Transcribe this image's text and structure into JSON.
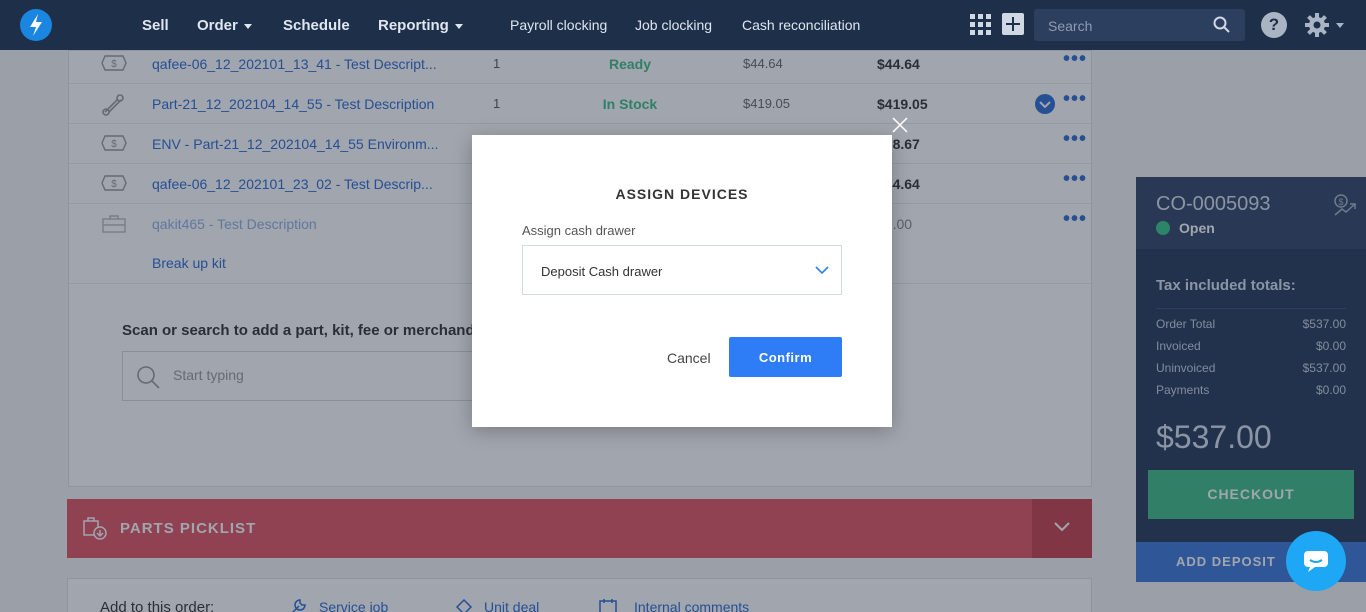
{
  "nav": {
    "items": [
      {
        "label": "Sell",
        "dropdown": false
      },
      {
        "label": "Order",
        "dropdown": true
      },
      {
        "label": "Schedule",
        "dropdown": false
      },
      {
        "label": "Reporting",
        "dropdown": true
      }
    ],
    "sub_items": [
      "Payroll clocking",
      "Job clocking",
      "Cash reconciliation"
    ],
    "search_placeholder": "Search",
    "help_label": "?"
  },
  "line_items": [
    {
      "name": "qafee-06_12_202101_13_41 - Test Descript...",
      "qty": "1",
      "status": "Ready",
      "status_color": "#3dbd86",
      "price": "$44.64",
      "total": "$44.64",
      "icon": "fee-icon"
    },
    {
      "name": "Part-21_12_202104_14_55 - Test Description",
      "qty": "1",
      "status": "In Stock",
      "status_color": "#3dbd86",
      "price": "$419.05",
      "total": "$419.05",
      "icon": "part-icon"
    },
    {
      "name": "ENV - Part-21_12_202104_14_55 Environm...",
      "qty": "",
      "status": "",
      "status_color": "",
      "price": "",
      "total": "$28.67",
      "icon": "fee-icon"
    },
    {
      "name": "qafee-06_12_202101_23_02 - Test Descrip...",
      "qty": "",
      "status": "",
      "status_color": "",
      "price": "",
      "total": "$44.64",
      "icon": "fee-icon"
    },
    {
      "name": "qakit465 - Test Description",
      "qty": "",
      "status": "",
      "status_color": "",
      "price": "",
      "total": "$0.00",
      "icon": "kit-icon"
    }
  ],
  "break_up_kit": "Break up kit",
  "scan": {
    "label": "Scan or search to add a part, kit, fee or merchandise",
    "placeholder": "Start typing"
  },
  "picklist": {
    "title": "PARTS PICKLIST"
  },
  "add_bar": {
    "label": "Add to this order:",
    "links": [
      "Service job",
      "Unit deal",
      "Internal comments"
    ]
  },
  "summary": {
    "order_number": "CO-0005093",
    "status": "Open",
    "tax_heading": "Tax included totals:",
    "rows": [
      {
        "label": "Order Total",
        "value": "$537.00"
      },
      {
        "label": "Invoiced",
        "value": "$0.00"
      },
      {
        "label": "Uninvoiced",
        "value": "$537.00"
      },
      {
        "label": "Payments",
        "value": "$0.00"
      }
    ],
    "balance": "$537.00",
    "checkout_label": "CHECKOUT",
    "deposit_label": "ADD DEPOSIT"
  },
  "modal": {
    "title": "ASSIGN DEVICES",
    "field_label": "Assign cash drawer",
    "selected_value": "Deposit Cash drawer",
    "cancel_label": "Cancel",
    "confirm_label": "Confirm"
  },
  "colors": {
    "nav_bg": "#1e2f4a",
    "accent_blue": "#2f7df6",
    "link_blue": "#2b6bd4",
    "success_green": "#3dbd86",
    "picklist_red": "#e25563",
    "summary_bg": "#25395a"
  }
}
